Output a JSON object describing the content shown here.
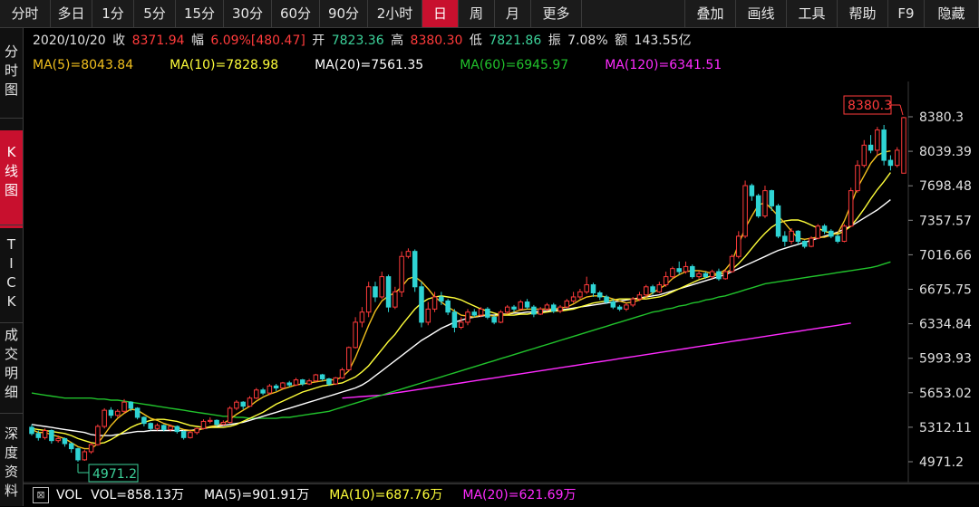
{
  "toolbar": {
    "tabs": [
      "分时",
      "多日",
      "1分",
      "5分",
      "15分",
      "30分",
      "60分",
      "90分",
      "2小时",
      "日",
      "周",
      "月",
      "更多"
    ],
    "active_tab": "日",
    "actions": [
      "叠加",
      "画线",
      "工具",
      "帮助",
      "F9",
      "隐藏"
    ]
  },
  "sidebar": {
    "items": [
      {
        "label": "分时图",
        "active": false
      },
      {
        "label": "K线图",
        "active": true
      },
      {
        "label": "TICK",
        "active": false
      },
      {
        "label": "成交明细",
        "active": false
      },
      {
        "label": "深度资料",
        "active": false
      }
    ]
  },
  "info": {
    "date": "2020/10/20",
    "close_label": "收",
    "close": "8371.94",
    "change_label": "幅",
    "change": "6.09%[480.47]",
    "open_label": "开",
    "open": "7823.36",
    "high_label": "高",
    "high": "8380.30",
    "low_label": "低",
    "low": "7821.86",
    "amp_label": "振",
    "amp": "7.08%",
    "amount_label": "额",
    "amount": "143.55亿"
  },
  "ma_legend": [
    {
      "text": "MA(5)=8043.84",
      "color": "#f2c01e"
    },
    {
      "text": "MA(10)=7828.98",
      "color": "#ffff3a"
    },
    {
      "text": "MA(20)=7561.35",
      "color": "#ffffff"
    },
    {
      "text": "MA(60)=6945.97",
      "color": "#21c22c"
    },
    {
      "text": "MA(120)=6341.51",
      "color": "#ff2bff"
    }
  ],
  "volume_legend": {
    "vol_label": "VOL",
    "vol": "VOL=858.13万",
    "ma5": "MA(5)=901.91万",
    "ma10": "MA(10)=687.76万",
    "ma20": "MA(20)=621.69万",
    "colors": {
      "vol": "#ffffff",
      "ma5": "#ffffff",
      "ma10": "#ffff3a",
      "ma20": "#ff2bff"
    }
  },
  "colors": {
    "up": "#ff3b3b",
    "down": "#2fd4d4",
    "high_marker": "#ff3b3b",
    "low_marker": "#3cd29a"
  },
  "chart_data": {
    "type": "candlestick",
    "y_ticks": [
      "8380.3",
      "8039.39",
      "7698.48",
      "7357.57",
      "7016.66",
      "6675.75",
      "6334.84",
      "5993.93",
      "5653.02",
      "5312.11",
      "4971.2"
    ],
    "ylim": [
      4971.2,
      8380.3
    ],
    "high_marker": "8380.3",
    "low_marker": "4971.2",
    "candles": [
      [
        5312,
        5250,
        5340,
        5230
      ],
      [
        5250,
        5210,
        5280,
        5180
      ],
      [
        5210,
        5280,
        5300,
        5190
      ],
      [
        5280,
        5180,
        5290,
        5150
      ],
      [
        5180,
        5200,
        5230,
        5160
      ],
      [
        5200,
        5150,
        5210,
        5120
      ],
      [
        5150,
        5100,
        5160,
        5060
      ],
      [
        5100,
        4990,
        5110,
        4971
      ],
      [
        4990,
        5070,
        5090,
        4980
      ],
      [
        5070,
        5140,
        5160,
        5050
      ],
      [
        5140,
        5320,
        5340,
        5130
      ],
      [
        5320,
        5480,
        5500,
        5300
      ],
      [
        5480,
        5430,
        5510,
        5400
      ],
      [
        5430,
        5470,
        5490,
        5410
      ],
      [
        5470,
        5560,
        5590,
        5450
      ],
      [
        5560,
        5500,
        5570,
        5470
      ],
      [
        5500,
        5410,
        5510,
        5390
      ],
      [
        5410,
        5350,
        5420,
        5320
      ],
      [
        5350,
        5300,
        5360,
        5280
      ],
      [
        5300,
        5330,
        5350,
        5280
      ],
      [
        5330,
        5290,
        5340,
        5270
      ],
      [
        5290,
        5320,
        5340,
        5270
      ],
      [
        5320,
        5270,
        5330,
        5250
      ],
      [
        5270,
        5210,
        5280,
        5190
      ],
      [
        5210,
        5260,
        5280,
        5200
      ],
      [
        5260,
        5300,
        5310,
        5240
      ],
      [
        5300,
        5370,
        5390,
        5290
      ],
      [
        5370,
        5380,
        5410,
        5350
      ],
      [
        5380,
        5340,
        5390,
        5320
      ],
      [
        5340,
        5360,
        5380,
        5330
      ],
      [
        5360,
        5500,
        5520,
        5350
      ],
      [
        5500,
        5560,
        5580,
        5480
      ],
      [
        5560,
        5520,
        5570,
        5490
      ],
      [
        5520,
        5600,
        5620,
        5510
      ],
      [
        5600,
        5680,
        5700,
        5590
      ],
      [
        5680,
        5650,
        5700,
        5630
      ],
      [
        5650,
        5720,
        5740,
        5630
      ],
      [
        5720,
        5700,
        5740,
        5670
      ],
      [
        5700,
        5750,
        5760,
        5690
      ],
      [
        5750,
        5730,
        5770,
        5710
      ],
      [
        5730,
        5780,
        5800,
        5720
      ],
      [
        5780,
        5740,
        5790,
        5720
      ],
      [
        5740,
        5770,
        5790,
        5730
      ],
      [
        5770,
        5830,
        5840,
        5760
      ],
      [
        5830,
        5790,
        5840,
        5770
      ],
      [
        5790,
        5740,
        5800,
        5720
      ],
      [
        5740,
        5800,
        5810,
        5730
      ],
      [
        5800,
        5880,
        5900,
        5790
      ],
      [
        5880,
        6100,
        6110,
        5870
      ],
      [
        6100,
        6350,
        6400,
        6090
      ],
      [
        6350,
        6450,
        6500,
        6300
      ],
      [
        6450,
        6700,
        6750,
        6400
      ],
      [
        6700,
        6600,
        6750,
        6550
      ],
      [
        6600,
        6800,
        6850,
        6580
      ],
      [
        6800,
        6500,
        6820,
        6450
      ],
      [
        6500,
        6650,
        6700,
        6480
      ],
      [
        6650,
        7000,
        7050,
        6600
      ],
      [
        7000,
        7050,
        7080,
        6980
      ],
      [
        7050,
        6700,
        7070,
        6650
      ],
      [
        6700,
        6350,
        6750,
        6300
      ],
      [
        6350,
        6480,
        6550,
        6320
      ],
      [
        6480,
        6600,
        6650,
        6450
      ],
      [
        6600,
        6560,
        6650,
        6520
      ],
      [
        6560,
        6450,
        6580,
        6420
      ],
      [
        6450,
        6300,
        6480,
        6250
      ],
      [
        6300,
        6350,
        6400,
        6280
      ],
      [
        6350,
        6450,
        6480,
        6320
      ],
      [
        6450,
        6420,
        6480,
        6400
      ],
      [
        6420,
        6480,
        6500,
        6400
      ],
      [
        6480,
        6400,
        6500,
        6380
      ],
      [
        6400,
        6350,
        6420,
        6330
      ],
      [
        6350,
        6450,
        6470,
        6340
      ],
      [
        6450,
        6500,
        6520,
        6430
      ],
      [
        6500,
        6480,
        6520,
        6450
      ],
      [
        6480,
        6550,
        6570,
        6470
      ],
      [
        6550,
        6500,
        6580,
        6480
      ],
      [
        6500,
        6430,
        6520,
        6400
      ],
      [
        6430,
        6480,
        6500,
        6420
      ],
      [
        6480,
        6520,
        6540,
        6460
      ],
      [
        6520,
        6460,
        6540,
        6440
      ],
      [
        6460,
        6500,
        6520,
        6440
      ],
      [
        6500,
        6560,
        6580,
        6490
      ],
      [
        6560,
        6600,
        6650,
        6540
      ],
      [
        6600,
        6650,
        6680,
        6580
      ],
      [
        6650,
        6720,
        6800,
        6630
      ],
      [
        6720,
        6640,
        6740,
        6600
      ],
      [
        6640,
        6600,
        6660,
        6570
      ],
      [
        6600,
        6550,
        6620,
        6530
      ],
      [
        6550,
        6500,
        6580,
        6480
      ],
      [
        6500,
        6480,
        6520,
        6460
      ],
      [
        6480,
        6520,
        6540,
        6460
      ],
      [
        6520,
        6580,
        6600,
        6500
      ],
      [
        6580,
        6620,
        6650,
        6560
      ],
      [
        6620,
        6700,
        6720,
        6600
      ],
      [
        6700,
        6650,
        6720,
        6620
      ],
      [
        6650,
        6720,
        6750,
        6640
      ],
      [
        6720,
        6800,
        6850,
        6700
      ],
      [
        6800,
        6880,
        6900,
        6780
      ],
      [
        6880,
        6850,
        6950,
        6820
      ],
      [
        6850,
        6900,
        6950,
        6830
      ],
      [
        6900,
        6800,
        6920,
        6780
      ],
      [
        6800,
        6830,
        6860,
        6780
      ],
      [
        6830,
        6800,
        6850,
        6780
      ],
      [
        6800,
        6850,
        6870,
        6780
      ],
      [
        6850,
        6780,
        6880,
        6760
      ],
      [
        6780,
        6850,
        6870,
        6770
      ],
      [
        6850,
        7000,
        7020,
        6840
      ],
      [
        7000,
        7200,
        7250,
        6980
      ],
      [
        7200,
        7700,
        7750,
        7180
      ],
      [
        7700,
        7600,
        7720,
        7550
      ],
      [
        7600,
        7400,
        7620,
        7380
      ],
      [
        7400,
        7650,
        7700,
        7380
      ],
      [
        7650,
        7500,
        7660,
        7450
      ],
      [
        7500,
        7200,
        7520,
        7180
      ],
      [
        7200,
        7150,
        7250,
        7100
      ],
      [
        7150,
        7250,
        7280,
        7120
      ],
      [
        7250,
        7150,
        7260,
        7120
      ],
      [
        7150,
        7100,
        7160,
        7080
      ],
      [
        7100,
        7180,
        7200,
        7090
      ],
      [
        7180,
        7300,
        7320,
        7170
      ],
      [
        7300,
        7250,
        7320,
        7220
      ],
      [
        7250,
        7200,
        7270,
        7180
      ],
      [
        7200,
        7150,
        7220,
        7130
      ],
      [
        7150,
        7300,
        7320,
        7140
      ],
      [
        7300,
        7650,
        7680,
        7290
      ],
      [
        7650,
        7900,
        7950,
        7630
      ],
      [
        7900,
        8100,
        8150,
        7880
      ],
      [
        8100,
        8050,
        8200,
        8020
      ],
      [
        8050,
        8250,
        8280,
        8000
      ],
      [
        8250,
        7950,
        8300,
        7900
      ],
      [
        7950,
        7900,
        8000,
        7850
      ],
      [
        7900,
        8050,
        8080,
        7880
      ],
      [
        7823,
        8372,
        8380,
        7822
      ]
    ],
    "ma5": [
      5290,
      5260,
      5260,
      5240,
      5220,
      5200,
      5160,
      5120,
      5100,
      5100,
      5150,
      5240,
      5330,
      5400,
      5450,
      5490,
      5480,
      5440,
      5400,
      5380,
      5350,
      5330,
      5310,
      5290,
      5280,
      5280,
      5300,
      5320,
      5330,
      5350,
      5390,
      5440,
      5480,
      5520,
      5570,
      5610,
      5640,
      5660,
      5690,
      5710,
      5730,
      5740,
      5750,
      5760,
      5770,
      5780,
      5780,
      5810,
      5870,
      6000,
      6160,
      6320,
      6460,
      6560,
      6610,
      6640,
      6700,
      6780,
      6800,
      6750,
      6680,
      6600,
      6550,
      6500,
      6460,
      6420,
      6410,
      6400,
      6420,
      6420,
      6410,
      6420,
      6430,
      6450,
      6470,
      6480,
      6480,
      6480,
      6480,
      6480,
      6490,
      6500,
      6530,
      6570,
      6600,
      6610,
      6610,
      6600,
      6580,
      6560,
      6540,
      6550,
      6570,
      6600,
      6640,
      6680,
      6720,
      6780,
      6820,
      6850,
      6860,
      6860,
      6850,
      6830,
      6830,
      6870,
      6950,
      7120,
      7280,
      7400,
      7510,
      7530,
      7470,
      7400,
      7330,
      7250,
      7180,
      7170,
      7180,
      7190,
      7190,
      7210,
      7230,
      7350,
      7510,
      7680,
      7800,
      7920,
      8000,
      8030,
      8043
    ],
    "ma10": [
      5300,
      5290,
      5280,
      5270,
      5260,
      5250,
      5230,
      5200,
      5180,
      5160,
      5150,
      5160,
      5190,
      5230,
      5270,
      5310,
      5340,
      5360,
      5380,
      5390,
      5390,
      5380,
      5370,
      5350,
      5330,
      5320,
      5310,
      5310,
      5310,
      5310,
      5320,
      5340,
      5370,
      5400,
      5430,
      5460,
      5500,
      5540,
      5570,
      5600,
      5630,
      5660,
      5680,
      5700,
      5720,
      5730,
      5740,
      5750,
      5780,
      5810,
      5860,
      5920,
      6000,
      6080,
      6160,
      6230,
      6320,
      6400,
      6480,
      6540,
      6580,
      6600,
      6610,
      6600,
      6590,
      6570,
      6540,
      6510,
      6480,
      6460,
      6440,
      6420,
      6420,
      6420,
      6430,
      6430,
      6440,
      6440,
      6450,
      6460,
      6460,
      6470,
      6480,
      6500,
      6520,
      6540,
      6550,
      6560,
      6570,
      6580,
      6580,
      6580,
      6580,
      6580,
      6590,
      6600,
      6620,
      6650,
      6680,
      6710,
      6740,
      6770,
      6790,
      6810,
      6820,
      6840,
      6870,
      6930,
      7000,
      7080,
      7160,
      7230,
      7290,
      7330,
      7350,
      7360,
      7360,
      7340,
      7310,
      7280,
      7250,
      7230,
      7220,
      7250,
      7300,
      7380,
      7470,
      7570,
      7660,
      7740,
      7829
    ],
    "ma20": [
      5340,
      5330,
      5320,
      5310,
      5300,
      5290,
      5280,
      5270,
      5260,
      5240,
      5230,
      5230,
      5230,
      5240,
      5250,
      5260,
      5270,
      5270,
      5280,
      5280,
      5280,
      5280,
      5280,
      5280,
      5280,
      5290,
      5300,
      5310,
      5320,
      5330,
      5340,
      5350,
      5360,
      5380,
      5400,
      5420,
      5440,
      5460,
      5480,
      5500,
      5520,
      5540,
      5560,
      5580,
      5600,
      5620,
      5640,
      5660,
      5680,
      5700,
      5730,
      5770,
      5820,
      5870,
      5920,
      5970,
      6020,
      6070,
      6120,
      6170,
      6210,
      6250,
      6290,
      6320,
      6350,
      6370,
      6390,
      6400,
      6410,
      6420,
      6420,
      6430,
      6430,
      6440,
      6440,
      6450,
      6450,
      6460,
      6460,
      6470,
      6470,
      6480,
      6490,
      6500,
      6510,
      6520,
      6530,
      6540,
      6550,
      6560,
      6570,
      6580,
      6590,
      6600,
      6610,
      6620,
      6640,
      6660,
      6680,
      6700,
      6720,
      6740,
      6760,
      6780,
      6800,
      6820,
      6850,
      6880,
      6910,
      6940,
      6970,
      7000,
      7030,
      7060,
      7080,
      7100,
      7120,
      7140,
      7160,
      7180,
      7200,
      7220,
      7240,
      7270,
      7300,
      7340,
      7380,
      7420,
      7460,
      7510,
      7561
    ],
    "ma60": [
      5650,
      5640,
      5630,
      5620,
      5610,
      5600,
      5600,
      5600,
      5600,
      5600,
      5590,
      5590,
      5580,
      5580,
      5570,
      5560,
      5550,
      5540,
      5530,
      5520,
      5510,
      5500,
      5490,
      5480,
      5470,
      5460,
      5450,
      5440,
      5430,
      5420,
      5420,
      5410,
      5410,
      5400,
      5400,
      5400,
      5400,
      5400,
      5410,
      5410,
      5420,
      5430,
      5440,
      5450,
      5460,
      5470,
      5490,
      5510,
      5530,
      5550,
      5570,
      5590,
      5610,
      5630,
      5650,
      5670,
      5690,
      5710,
      5730,
      5750,
      5770,
      5790,
      5810,
      5830,
      5850,
      5870,
      5890,
      5910,
      5930,
      5950,
      5970,
      5990,
      6010,
      6030,
      6050,
      6070,
      6090,
      6110,
      6130,
      6150,
      6170,
      6190,
      6210,
      6230,
      6250,
      6270,
      6290,
      6310,
      6330,
      6350,
      6370,
      6390,
      6410,
      6430,
      6450,
      6460,
      6480,
      6490,
      6510,
      6520,
      6540,
      6550,
      6570,
      6580,
      6600,
      6610,
      6630,
      6650,
      6670,
      6690,
      6710,
      6730,
      6740,
      6750,
      6760,
      6770,
      6780,
      6790,
      6800,
      6810,
      6820,
      6830,
      6840,
      6850,
      6860,
      6870,
      6880,
      6890,
      6905,
      6925,
      6946
    ],
    "ma120": [
      null,
      null,
      null,
      null,
      null,
      null,
      null,
      null,
      null,
      null,
      null,
      null,
      null,
      null,
      null,
      null,
      null,
      null,
      null,
      null,
      null,
      null,
      null,
      null,
      null,
      null,
      null,
      null,
      null,
      null,
      null,
      null,
      null,
      null,
      null,
      null,
      null,
      null,
      null,
      null,
      null,
      null,
      null,
      null,
      null,
      null,
      null,
      5600,
      5605,
      5610,
      5615,
      5620,
      5625,
      5630,
      5640,
      5650,
      5660,
      5670,
      5680,
      5690,
      5700,
      5710,
      5720,
      5730,
      5740,
      5750,
      5760,
      5770,
      5780,
      5790,
      5800,
      5810,
      5820,
      5830,
      5840,
      5850,
      5860,
      5870,
      5880,
      5890,
      5900,
      5910,
      5920,
      5930,
      5940,
      5950,
      5960,
      5970,
      5980,
      5990,
      6000,
      6010,
      6020,
      6030,
      6040,
      6050,
      6060,
      6070,
      6080,
      6090,
      6100,
      6110,
      6120,
      6130,
      6140,
      6150,
      6160,
      6170,
      6180,
      6190,
      6200,
      6210,
      6220,
      6230,
      6240,
      6250,
      6260,
      6270,
      6280,
      6290,
      6300,
      6310,
      6320,
      6330,
      6341
    ]
  }
}
